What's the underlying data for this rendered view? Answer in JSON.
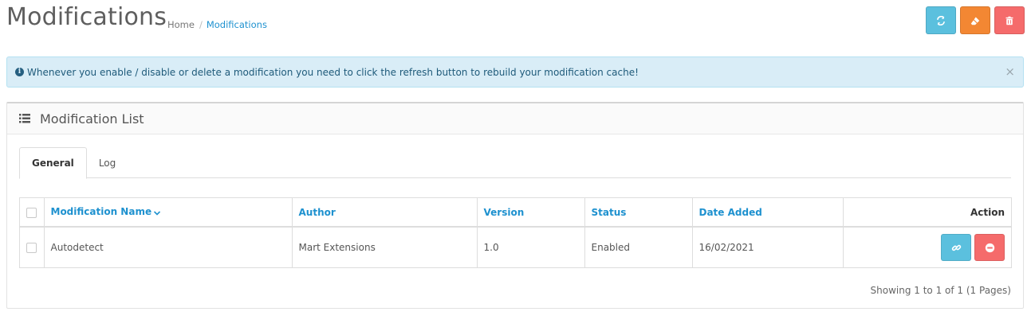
{
  "header": {
    "title": "Modifications",
    "breadcrumb": [
      {
        "label": "Home"
      },
      {
        "label": "Modifications"
      }
    ],
    "buttons": {
      "refresh_color": "#5bc0de",
      "clear_color": "#f38733",
      "delete_color": "#f56b6b"
    }
  },
  "alert": {
    "text": "Whenever you enable / disable or delete a modification you need to click the refresh button to rebuild your modification cache!",
    "close": "×"
  },
  "panel": {
    "title": "Modification List",
    "tabs": [
      {
        "label": "General",
        "active": true
      },
      {
        "label": "Log",
        "active": false
      }
    ],
    "table": {
      "headers": {
        "name": "Modification Name",
        "author": "Author",
        "version": "Version",
        "status": "Status",
        "date_added": "Date Added",
        "action": "Action"
      },
      "rows": [
        {
          "name": "Autodetect",
          "author": "Mart Extensions",
          "version": "1.0",
          "status": "Enabled",
          "date_added": "16/02/2021"
        }
      ]
    },
    "pagination_text": "Showing 1 to 1 of 1 (1 Pages)"
  }
}
